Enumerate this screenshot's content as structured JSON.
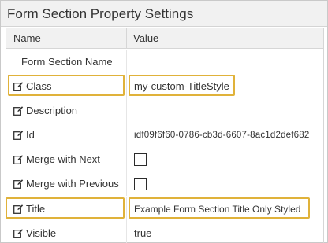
{
  "panel": {
    "title": "Form Section Property Settings"
  },
  "grid": {
    "header": {
      "name": "Name",
      "value": "Value"
    },
    "rows": [
      {
        "name": "Form Section Name",
        "value": "",
        "icon": ""
      },
      {
        "name": "Class",
        "value": "my-custom-TitleStyle",
        "icon": "edit-icon"
      },
      {
        "name": "Description",
        "value": "",
        "icon": "edit-icon"
      },
      {
        "name": "Id",
        "value": "idf09f6f60-0786-cb3d-6607-8ac1d2def682",
        "icon": "edit-icon"
      },
      {
        "name": "Merge with Next",
        "value": "",
        "icon": "edit-icon",
        "checked": false
      },
      {
        "name": "Merge with Previous",
        "value": "",
        "icon": "edit-icon",
        "checked": false
      },
      {
        "name": "Title",
        "value": "Example Form Section Title Only Styled",
        "icon": "edit-icon"
      },
      {
        "name": "Visible",
        "value": "true",
        "icon": "edit-icon"
      }
    ]
  },
  "colors": {
    "highlight": "#e0b23a",
    "header_bg": "#f1f1f1",
    "border": "#d6d6d6"
  }
}
